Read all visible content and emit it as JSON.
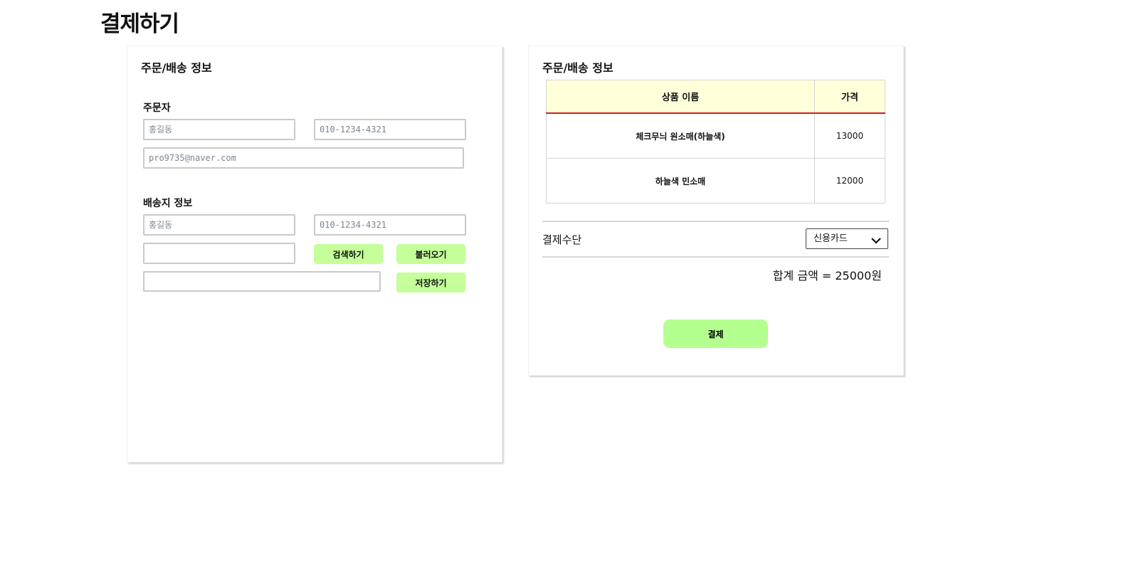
{
  "page": {
    "title": "결제하기"
  },
  "order_form": {
    "title": "주문/배송 정보",
    "orderer": {
      "label": "주문자",
      "name_placeholder": "홍길동",
      "phone_placeholder": "010-1234-4321",
      "email_placeholder": "pro9735@naver.com"
    },
    "shipping": {
      "label": "배송지 정보",
      "name_placeholder": "홍길동",
      "phone_placeholder": "010-1234-4321",
      "search_button": "검색하기",
      "load_button": "불러오기",
      "save_button": "저장하기"
    }
  },
  "summary": {
    "title": "주문/배송 정보",
    "columns": {
      "name": "상품 이름",
      "price": "가격"
    },
    "items": [
      {
        "name": "체크무늬 원소매(하늘색)",
        "price": "13000"
      },
      {
        "name": "하늘색 민소매",
        "price": "12000"
      }
    ],
    "payment_method_label": "결제수단",
    "payment_method_value": "신용카드",
    "total_text": "합계 금액 = 25000원",
    "pay_button": "결제"
  },
  "colors": {
    "button_green": "#c4ff99",
    "pay_button_green": "#b3ff8f",
    "table_header_bg": "#ffffd9",
    "table_header_underline": "#d01c1c"
  },
  "icons": {
    "select_chevron": "chevron-down-icon"
  }
}
